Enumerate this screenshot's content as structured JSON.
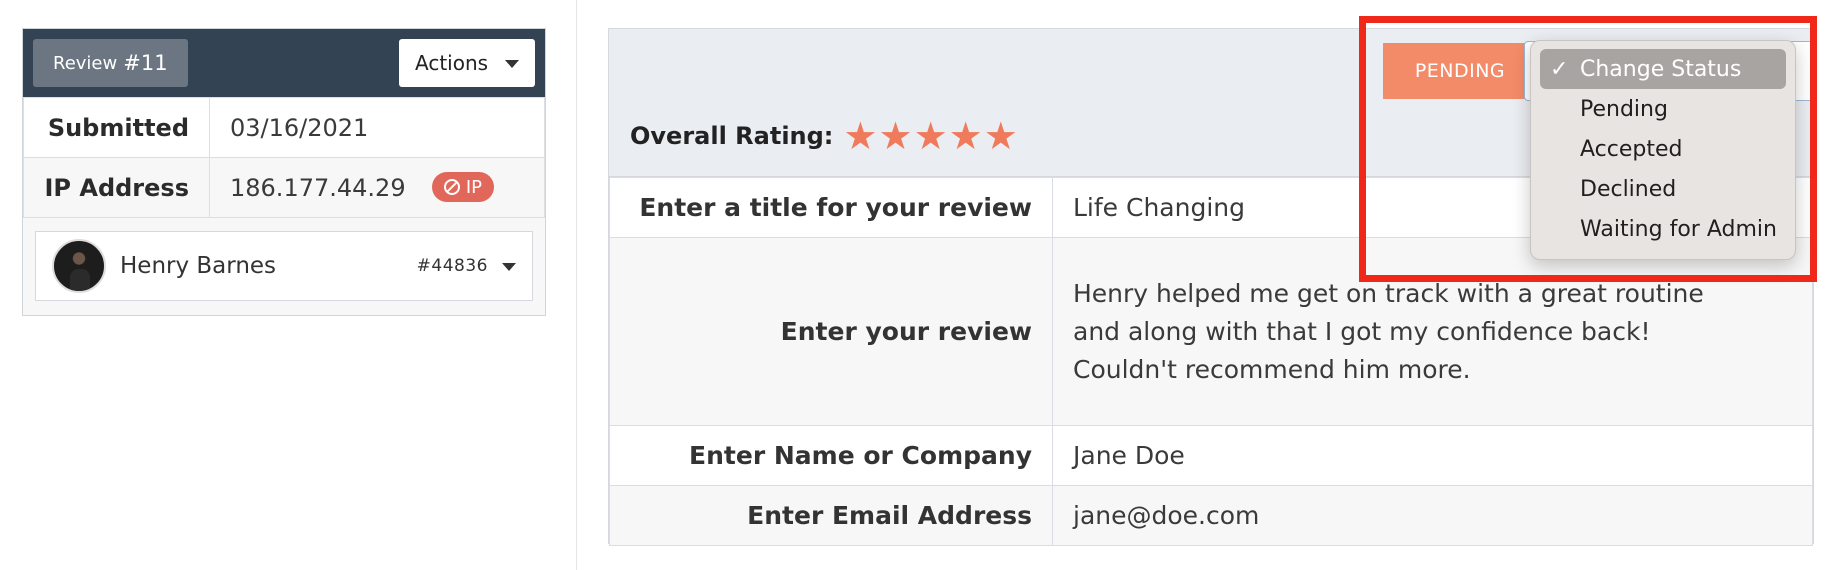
{
  "review": {
    "badge_label": "Review",
    "badge_number": "#11",
    "actions_label": "Actions"
  },
  "info": {
    "submitted_label": "Submitted",
    "submitted_value": "03/16/2021",
    "ip_label": "IP Address",
    "ip_value": "186.177.44.29",
    "ip_badge": "IP"
  },
  "user": {
    "name": "Henry Barnes",
    "id": "#44836"
  },
  "header": {
    "overall_label": "Overall Rating:",
    "rating": 5,
    "rating_max": 5,
    "status_button": "PENDING"
  },
  "dropdown": {
    "options": [
      {
        "label": "Change Status",
        "selected": true
      },
      {
        "label": "Pending",
        "selected": false
      },
      {
        "label": "Accepted",
        "selected": false
      },
      {
        "label": "Declined",
        "selected": false
      },
      {
        "label": "Waiting for Admin",
        "selected": false
      }
    ]
  },
  "fields": [
    {
      "label": "Enter a title for your review",
      "value": "Life Changing"
    },
    {
      "label": "Enter your review",
      "value": "Henry helped me get on track with a great routine and along with that I got my confidence back! Couldn't recommend him more."
    },
    {
      "label": "Enter Name or Company",
      "value": "Jane Doe"
    },
    {
      "label": "Enter Email Address",
      "value": "jane@doe.com"
    }
  ],
  "colors": {
    "header_dark": "#344354",
    "star": "#f07a5c",
    "pending": "#f48b68",
    "ip_badge": "#e0675a",
    "highlight": "#f0281a"
  }
}
